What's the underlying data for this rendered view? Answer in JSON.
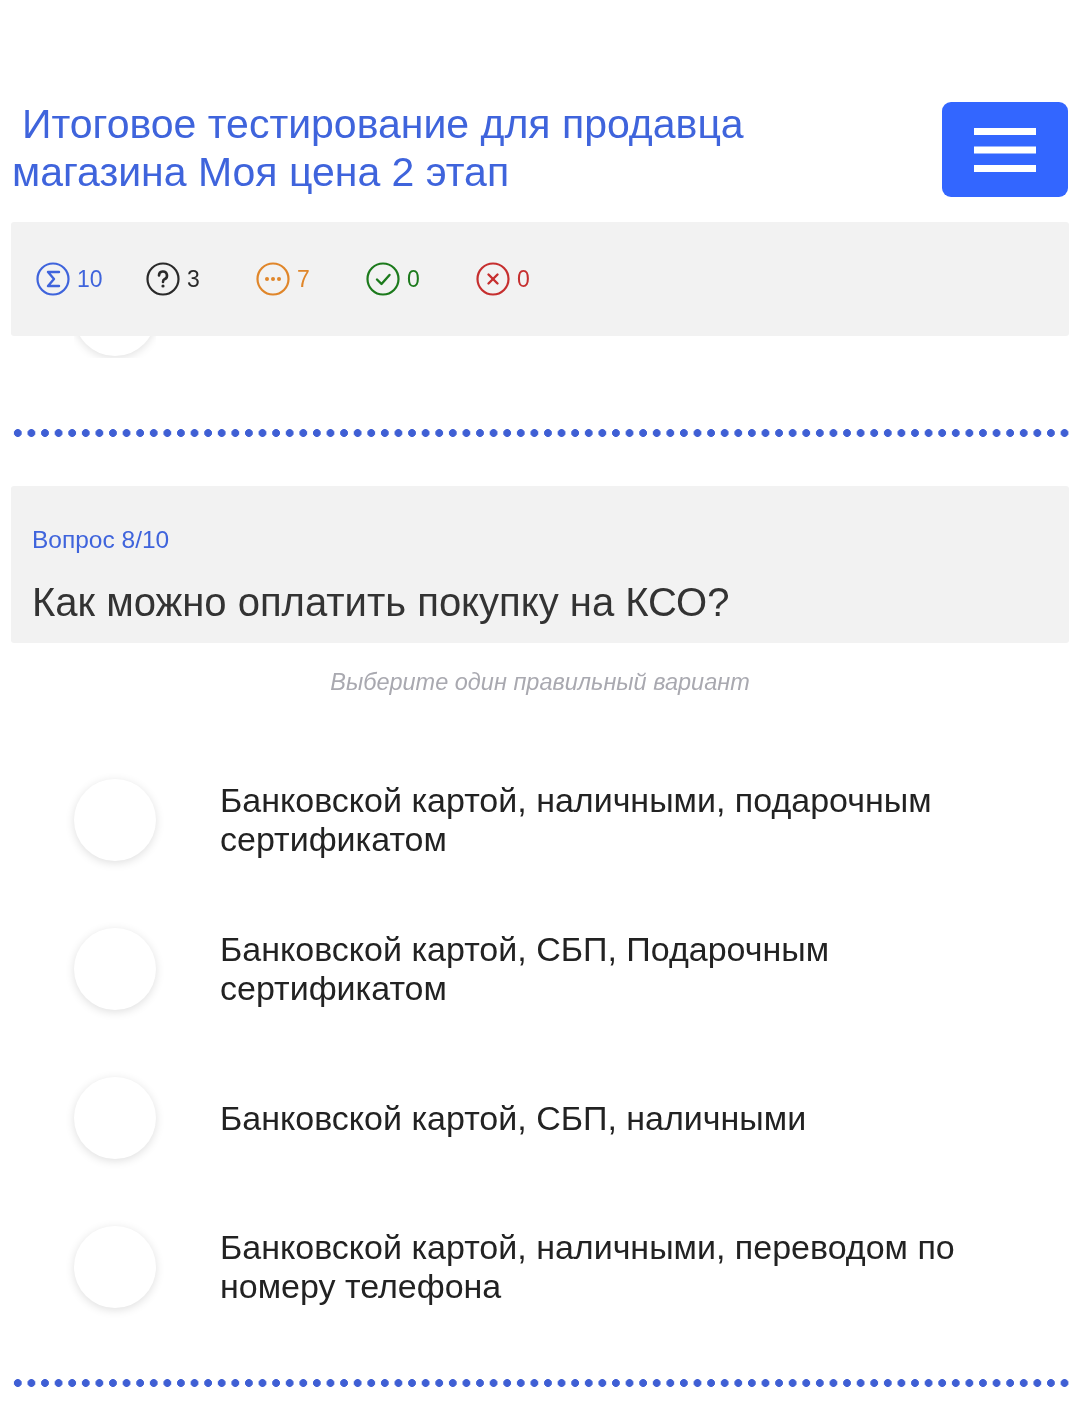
{
  "header": {
    "title": "Итоговое тестирование для продавца магазина Моя цена 2 этап"
  },
  "stats": [
    {
      "kind": "total",
      "count": "10",
      "color": "#3f64dc"
    },
    {
      "kind": "question",
      "count": "3",
      "color": "#2a2a2a"
    },
    {
      "kind": "pending",
      "count": "7",
      "color": "#e0862a"
    },
    {
      "kind": "correct",
      "count": "0",
      "color": "#1c7a1c"
    },
    {
      "kind": "wrong",
      "count": "0",
      "color": "#c62f2f"
    }
  ],
  "question": {
    "number": "Вопрос 8/10",
    "text": "Как можно оплатить покупку на КСО?",
    "hint": "Выберите один правильный вариант"
  },
  "options": [
    {
      "label": "Банковской картой, наличными, подарочным сертификатом",
      "selected": false
    },
    {
      "label": "Банковской картой, СБП, Подарочным сертификатом",
      "selected": false
    },
    {
      "label": "Банковской картой, СБП, наличными",
      "selected": false
    },
    {
      "label": "Банковской картой, наличными, переводом по номеру телефона",
      "selected": false
    }
  ]
}
